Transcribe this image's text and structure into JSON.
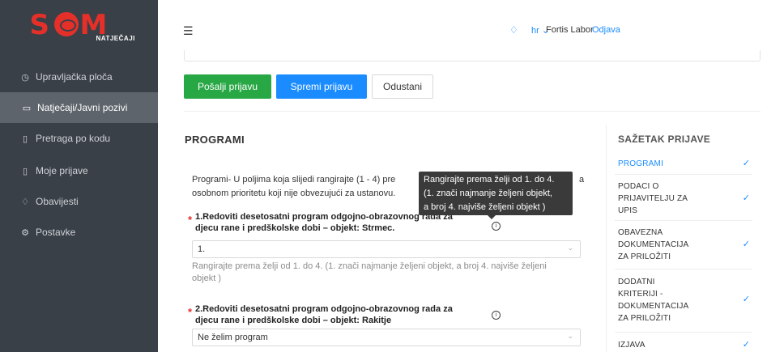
{
  "brand": {
    "logo_text_s": "S",
    "logo_text_m": "M",
    "logo_sub": "NATJEČAJI"
  },
  "sidebar": {
    "items": [
      {
        "label": "Upravljačka ploča",
        "icon": "dashboard-icon"
      },
      {
        "label": "Natječaji/Javni pozivi",
        "icon": "folder-icon",
        "active": true
      },
      {
        "label": "Pretraga po kodu",
        "icon": "document-icon"
      },
      {
        "label": "Moje prijave",
        "icon": "document-icon"
      },
      {
        "label": "Obavijesti",
        "icon": "bell-icon"
      },
      {
        "label": "Postavke",
        "icon": "gear-icon"
      }
    ]
  },
  "topbar": {
    "language": "hr",
    "user_name": "Fortis Labor",
    "logout_label": "Odjava"
  },
  "actions": {
    "send_label": "Pošalji prijavu",
    "save_label": "Spremi prijavu",
    "cancel_label": "Odustani"
  },
  "main": {
    "section_title": "PROGRAMI",
    "intro_line1": "Programi- U poljima koja slijedi rangirajte (1 - 4) pre",
    "intro_line1_end": "a",
    "intro_line2": "osobnom prioritetu koji nije obvezujući za ustanovu.",
    "questions": [
      {
        "label_line1": "1.Redoviti desetosatni program odgojno-obrazovnog rada za",
        "label_line2": "djecu rane i predškolske dobi – objekt: Strmec.",
        "selected": "1.",
        "help_line1": "Rangirajte prema želji od 1. do 4. (1. znači najmanje željeni objekt, a broj 4. najviše željeni",
        "help_line2": "objekt )"
      },
      {
        "label_line1": "2.Redoviti desetosatni program odgojno-obrazovnog rada za",
        "label_line2": "djecu rane i predškolske dobi – objekt: Rakitje",
        "selected": "Ne želim program"
      }
    ],
    "tooltip_line1": "Rangirajte prema želji od 1. do 4.",
    "tooltip_line2": "(1. znači najmanje željeni objekt,",
    "tooltip_line3": "a broj 4. najviše željeni objekt )"
  },
  "summary": {
    "title": "SAŽETAK PRIJAVE",
    "items": [
      {
        "line1": "PROGRAMI",
        "active": true
      },
      {
        "line1": "PODACI O",
        "line2": "PRIJAVITELJU ZA",
        "line3": "UPIS"
      },
      {
        "line1": "OBAVEZNA",
        "line2": "DOKUMENTACIJA",
        "line3": "ZA PRILOŽITI"
      },
      {
        "line1": "DODATNI",
        "line2": "KRITERIJI -",
        "line3": "DOKUMENTACIJA",
        "line4": "ZA PRILOŽITI"
      },
      {
        "line1": "IZJAVA"
      }
    ],
    "check_glyph": "✓"
  },
  "colors": {
    "accent": "#1a8cff",
    "success": "#28a745",
    "sidebar": "#3a4047",
    "brand_red": "#e5302a"
  }
}
